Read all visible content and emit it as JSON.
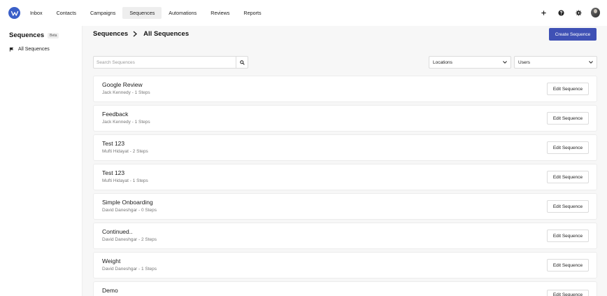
{
  "nav": {
    "items": [
      {
        "label": "Inbox",
        "active": false
      },
      {
        "label": "Contacts",
        "active": false
      },
      {
        "label": "Campaigns",
        "active": false
      },
      {
        "label": "Sequences",
        "active": true
      },
      {
        "label": "Automations",
        "active": false
      },
      {
        "label": "Reviews",
        "active": false
      },
      {
        "label": "Reports",
        "active": false
      }
    ],
    "icons": [
      "plus-icon",
      "help-icon",
      "gear-icon",
      "avatar"
    ]
  },
  "sidebar": {
    "title": "Sequences",
    "badge": "Beta",
    "items": [
      {
        "label": "All Sequences",
        "icon": "sequence-icon"
      }
    ]
  },
  "header": {
    "breadcrumb_root": "Sequences",
    "breadcrumb_current": "All Sequences",
    "create_label": "Create Sequence"
  },
  "filters": {
    "search_placeholder": "Search Sequences",
    "locations": "Locations",
    "users": "Users"
  },
  "sequences": [
    {
      "title": "Google Review",
      "subtitle": "Jack Kennedy - 1 Steps",
      "action": "Edit Sequence"
    },
    {
      "title": "Feedback",
      "subtitle": "Jack Kennedy - 1 Steps",
      "action": "Edit Sequence"
    },
    {
      "title": "Test 123",
      "subtitle": "Mufti Hidayat - 2 Steps",
      "action": "Edit Sequence"
    },
    {
      "title": "Test 123",
      "subtitle": "Mufti Hidayat - 1 Steps",
      "action": "Edit Sequence"
    },
    {
      "title": "Simple Onboarding",
      "subtitle": "David Daneshgar - 0 Steps",
      "action": "Edit Sequence"
    },
    {
      "title": "Continued..",
      "subtitle": "David Daneshgar - 2 Steps",
      "action": "Edit Sequence"
    },
    {
      "title": "Weight",
      "subtitle": "David Daneshgar - 1 Steps",
      "action": "Edit Sequence"
    },
    {
      "title": "Demo",
      "subtitle": "",
      "action": "Edit Sequence"
    }
  ],
  "colors": {
    "brand": "#3a5fc8",
    "primary_button": "#3f51b5",
    "background": "#f7f7f7"
  }
}
